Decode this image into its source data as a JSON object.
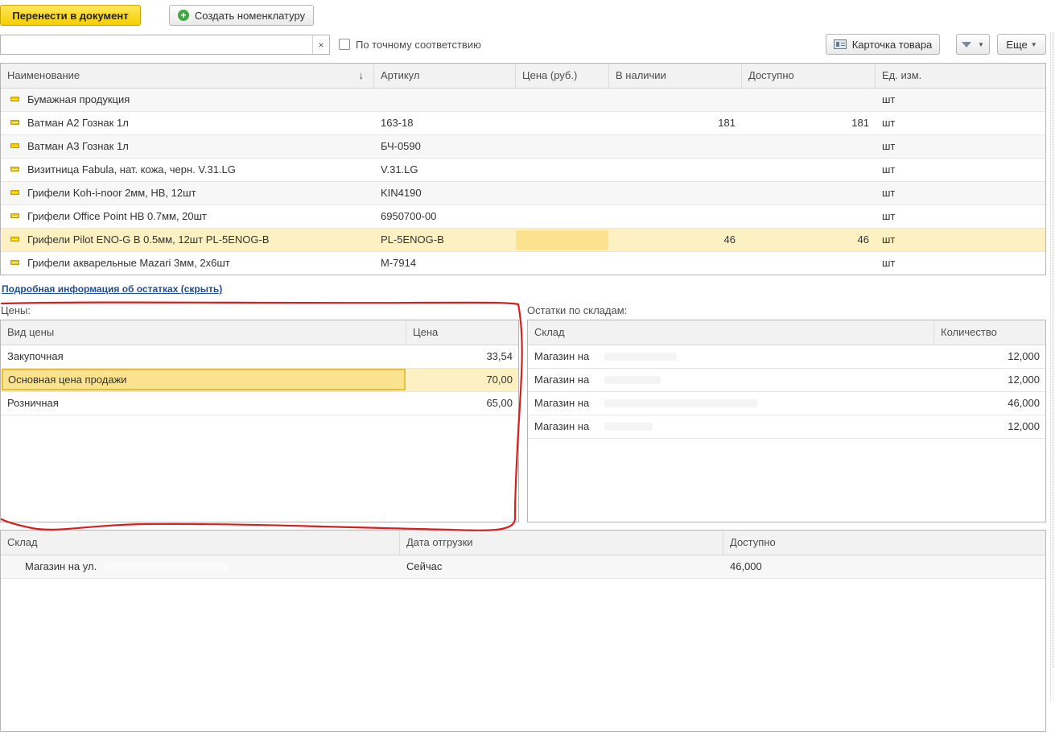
{
  "toolbar": {
    "transfer_label": "Перенести в документ",
    "create_label": "Создать номенклатуру",
    "search_value": "",
    "search_clear": "×",
    "exact_match_label": "По точному соответствию",
    "product_card_label": "Карточка товара",
    "more_label": "Еще"
  },
  "main_table": {
    "columns": [
      "Наименование",
      "Артикул",
      "Цена (руб.)",
      "В наличии",
      "Доступно",
      "Ед. изм."
    ],
    "sort_indicator": "↓",
    "rows": [
      {
        "name": "Бумажная продукция",
        "article": "",
        "price": "",
        "in_stock": "",
        "available": "",
        "unit": "шт"
      },
      {
        "name": "Ватман А2 Гознак 1л",
        "article": "163-18",
        "price": "",
        "in_stock": "181",
        "available": "181",
        "unit": "шт"
      },
      {
        "name": "Ватман А3 Гознак 1л",
        "article": "БЧ-0590",
        "price": "",
        "in_stock": "",
        "available": "",
        "unit": "шт"
      },
      {
        "name": "Визитница Fabula, нат. кожа, черн. V.31.LG",
        "article": "V.31.LG",
        "price": "",
        "in_stock": "",
        "available": "",
        "unit": "шт"
      },
      {
        "name": "Грифели Koh-i-noor 2мм, HB, 12шт",
        "article": "KIN4190",
        "price": "",
        "in_stock": "",
        "available": "",
        "unit": "шт"
      },
      {
        "name": "Грифели Office Point HB 0.7мм, 20шт",
        "article": "6950700-00",
        "price": "",
        "in_stock": "",
        "available": "",
        "unit": "шт"
      },
      {
        "name": "Грифели Pilot ENO-G B 0.5мм, 12шт PL-5ENOG-B",
        "article": "PL-5ENOG-B",
        "price": "",
        "in_stock": "46",
        "available": "46",
        "unit": "шт"
      },
      {
        "name": "Грифели акварельные Mazari 3мм, 2х6шт",
        "article": "M-7914",
        "price": "",
        "in_stock": "",
        "available": "",
        "unit": "шт"
      }
    ]
  },
  "details_link": "Подробная информация об остатках (скрыть)",
  "prices": {
    "label": "Цены:",
    "columns": [
      "Вид цены",
      "Цена"
    ],
    "rows": [
      {
        "type": "Закупочная",
        "price": "33,54"
      },
      {
        "type": "Основная цена продажи",
        "price": "70,00"
      },
      {
        "type": "Розничная",
        "price": "65,00"
      }
    ]
  },
  "stock": {
    "label": "Остатки по складам:",
    "columns": [
      "Склад",
      "Количество"
    ],
    "rows": [
      {
        "warehouse": "Магазин на",
        "qty": "12,000"
      },
      {
        "warehouse": "Магазин на",
        "qty": "12,000"
      },
      {
        "warehouse": "Магазин на",
        "qty": "46,000"
      },
      {
        "warehouse": "Магазин на",
        "qty": "12,000"
      }
    ]
  },
  "shipment": {
    "columns": [
      "Склад",
      "Дата отгрузки",
      "Доступно"
    ],
    "rows": [
      {
        "warehouse": "Магазин на ул.",
        "date": "Сейчас",
        "available": "46,000"
      }
    ]
  },
  "colors": {
    "primary_button": "#f5cf00",
    "selection": "#fbe28e",
    "annotation": "#d42020",
    "link": "#1f4e91"
  }
}
